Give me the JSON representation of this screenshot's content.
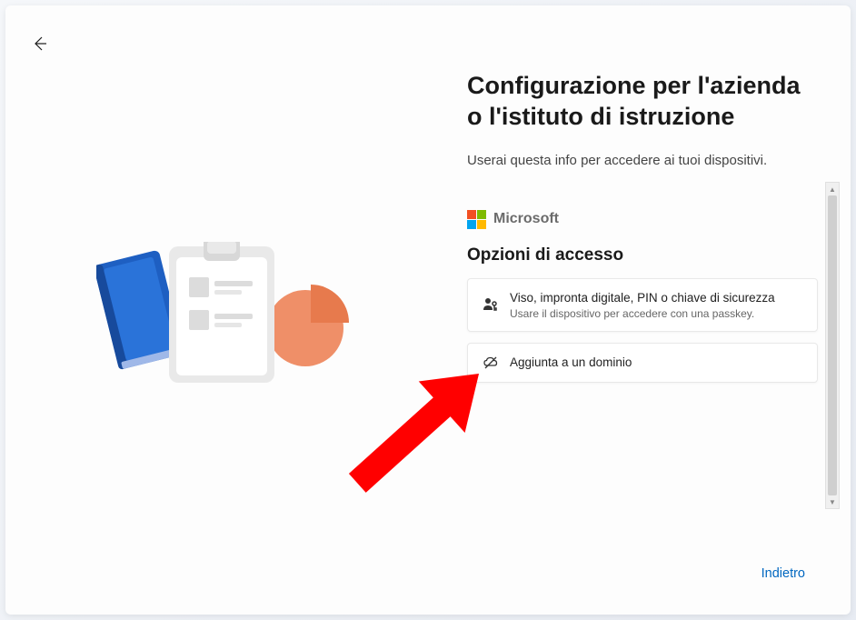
{
  "heading": "Configurazione per l'azienda o l'istituto di istruzione",
  "subtitle": "Userai questa info per accedere ai tuoi dispositivi.",
  "brand": "Microsoft",
  "section_title": "Opzioni di accesso",
  "options": [
    {
      "title": "Viso, impronta digitale, PIN o chiave di sicurezza",
      "subtitle": "Usare il dispositivo per accedere con una passkey."
    },
    {
      "title": "Aggiunta a un dominio",
      "subtitle": ""
    }
  ],
  "footer_back": "Indietro"
}
